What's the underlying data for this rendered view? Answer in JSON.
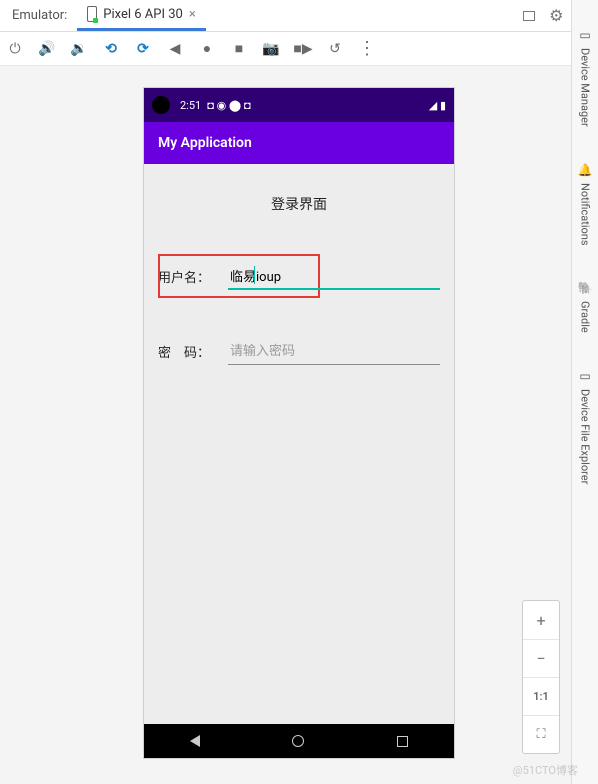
{
  "tabbar": {
    "label": "Emulator:",
    "device_tab": "Pixel 6 API 30"
  },
  "toolbar": {
    "power": "⏻",
    "vol_up": "🔊",
    "vol_down": "🔉",
    "rotate_left": "⟲",
    "rotate_right": "⟳",
    "back_tri": "◀",
    "record": "●",
    "stop": "■",
    "camera": "📷",
    "video": "■▶",
    "history": "↺",
    "more": "⋮"
  },
  "status": {
    "time": "2:51",
    "indicators": "◘ ◉ ⬤ ◘",
    "right": "◢ ▮"
  },
  "app": {
    "title": "My Application",
    "page_title": "登录界面",
    "username_label": "用户名：",
    "username_value": "临易ioup",
    "password_label": "密　码：",
    "password_placeholder": "请输入密码"
  },
  "rail": {
    "items": [
      "Device Manager",
      "Notifications",
      "Gradle",
      "Device File Explorer"
    ],
    "icons": [
      "▭",
      "🔔",
      "🐘",
      "▭"
    ]
  },
  "zoom": {
    "plus": "+",
    "minus": "−",
    "ratio": "1:1",
    "fit": "⛶"
  },
  "watermark": "@51CTO博客"
}
